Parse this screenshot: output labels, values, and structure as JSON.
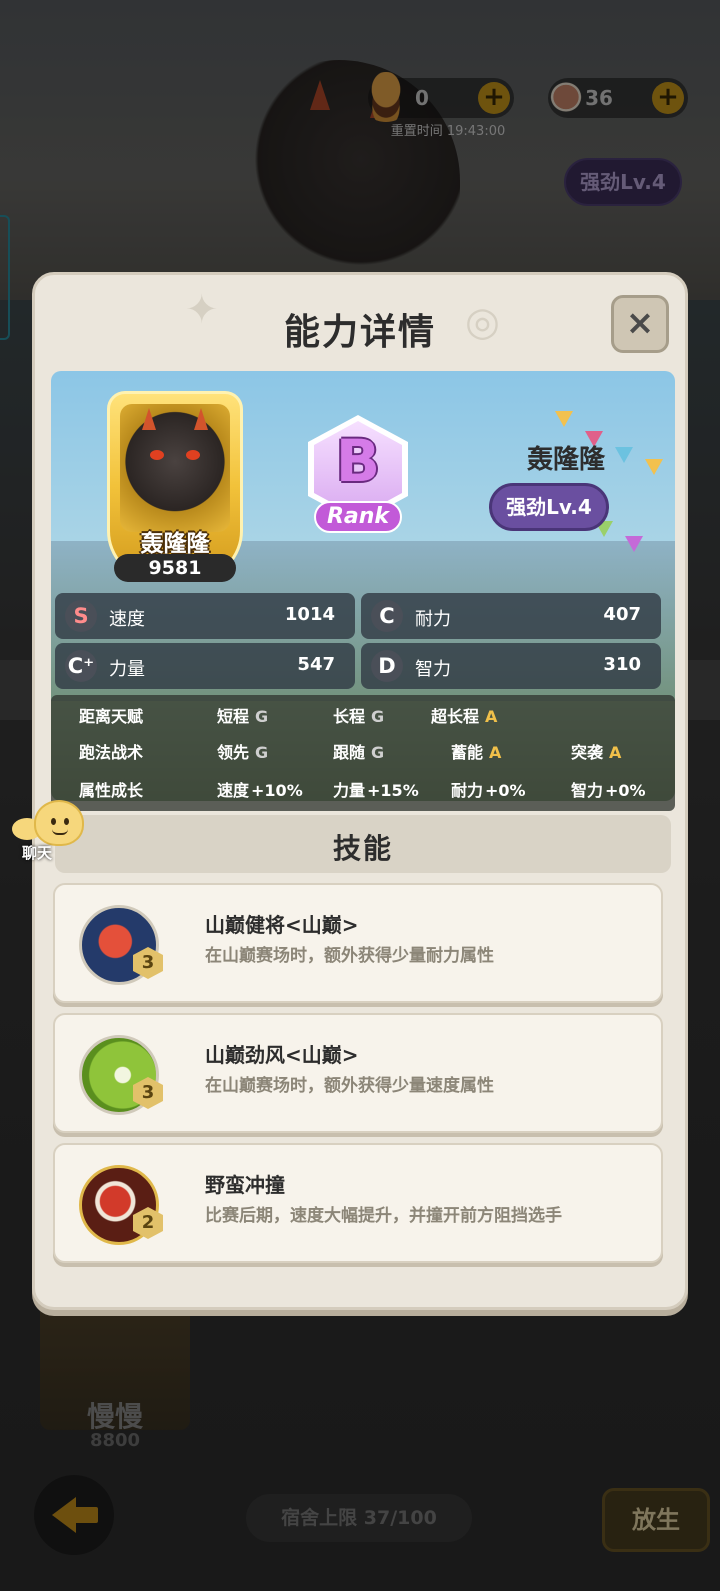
{
  "resources": {
    "burger": {
      "icon": "burger-icon",
      "value": "0"
    },
    "meat": {
      "icon": "meat-icon",
      "value": "36"
    },
    "plus_label": "+",
    "reset_time": "重置时间 19:43:00"
  },
  "background": {
    "level_pill": "强劲Lv.4",
    "frame_name": "慢慢",
    "frame_score": "8800",
    "dorm_limit": "宿舍上限 37/100",
    "release_label": "放生"
  },
  "modal": {
    "title": "能力详情",
    "close_label": "×",
    "hero": {
      "portrait_name": "轰隆隆",
      "score": "9581",
      "rank_letter": "B",
      "rank_label": "Rank",
      "name": "轰隆隆",
      "level": "强劲Lv.4"
    },
    "stats": [
      {
        "grade": "S",
        "name": "速度",
        "value": "1014"
      },
      {
        "grade": "C",
        "name": "耐力",
        "value": "407"
      },
      {
        "grade": "C⁺",
        "name": "力量",
        "value": "547"
      },
      {
        "grade": "D",
        "name": "智力",
        "value": "310"
      }
    ],
    "attributes": {
      "distance": {
        "label": "距离天赋",
        "items": [
          {
            "name": "短程",
            "grade": "G"
          },
          {
            "name": "长程",
            "grade": "G"
          },
          {
            "name": "超长程",
            "grade": "A"
          }
        ]
      },
      "tactics": {
        "label": "跑法战术",
        "items": [
          {
            "name": "领先",
            "grade": "G"
          },
          {
            "name": "跟随",
            "grade": "G"
          },
          {
            "name": "蓄能",
            "grade": "A"
          },
          {
            "name": "突袭",
            "grade": "A"
          }
        ]
      },
      "growth": {
        "label": "属性成长",
        "items": [
          {
            "name": "速度",
            "value": "+10%"
          },
          {
            "name": "力量",
            "value": "+15%"
          },
          {
            "name": "耐力",
            "value": "+0%"
          },
          {
            "name": "智力",
            "value": "+0%"
          }
        ]
      }
    },
    "skills_title": "技能",
    "skills": [
      {
        "name": "山巅健将<山巅>",
        "desc": "在山巅赛场时，额外获得少量耐力属性",
        "level": "3",
        "icon": "heart-plus-icon"
      },
      {
        "name": "山巅劲风<山巅>",
        "desc": "在山巅赛场时，额外获得少量速度属性",
        "level": "3",
        "icon": "wind-icon"
      },
      {
        "name": "野蛮冲撞",
        "desc": "比赛后期，速度大幅提升，并撞开前方阻挡选手",
        "level": "2",
        "icon": "charge-icon"
      }
    ]
  },
  "chat": {
    "label": "聊天"
  }
}
